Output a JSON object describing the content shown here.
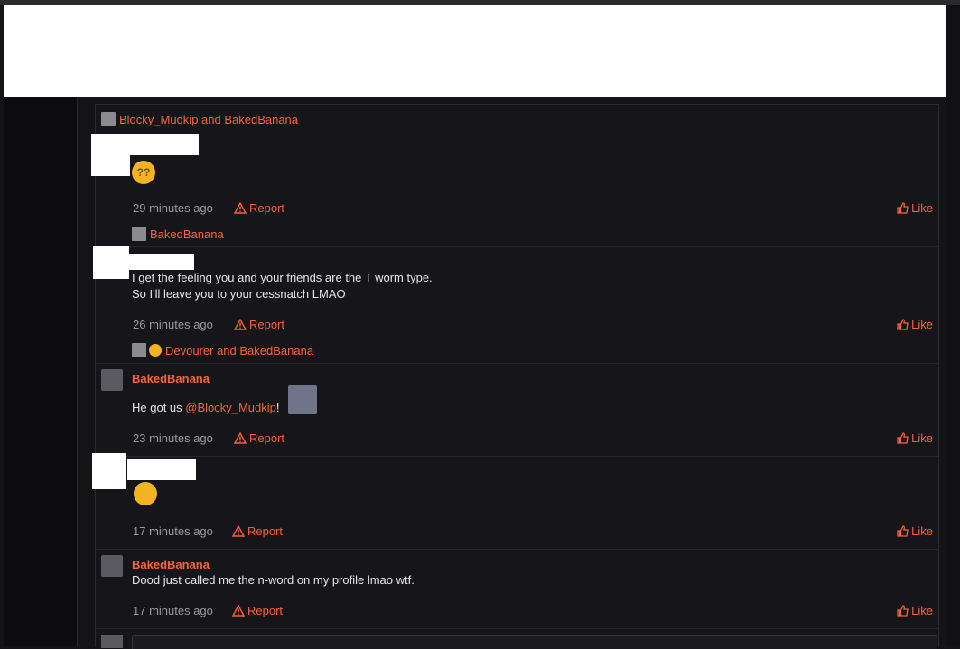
{
  "reply_context": [
    {
      "text": "Blocky_Mudkip and BakedBanana"
    },
    {
      "text": "BakedBanana"
    },
    {
      "text": "Devourer and BakedBanana"
    }
  ],
  "comments": [
    {
      "author": "",
      "body_lines": [],
      "emoji": "??",
      "time": "29 minutes ago"
    },
    {
      "author": "",
      "body_lines": [
        "I get the feeling you and your friends are the T worm type.",
        "So I'll leave you to your cessnatch LMAO"
      ],
      "time": "26 minutes ago"
    },
    {
      "author": "BakedBanana",
      "body_prefix": "He got us ",
      "mention": "@Blocky_Mudkip",
      "body_suffix": "!",
      "time": "23 minutes ago"
    },
    {
      "author": "",
      "body_lines": [],
      "time": "17 minutes ago"
    },
    {
      "author": "BakedBanana",
      "body_lines": [
        "Dood just called me the n-word on my profile lmao wtf."
      ],
      "time": "17 minutes ago"
    }
  ],
  "actions": {
    "report": "Report",
    "like": "Like"
  },
  "colors": {
    "accent": "#f5613d",
    "background": "#141417",
    "panel": "#16161a"
  },
  "icons": {
    "report": "warning-triangle-icon",
    "like": "thumbs-up-icon"
  }
}
